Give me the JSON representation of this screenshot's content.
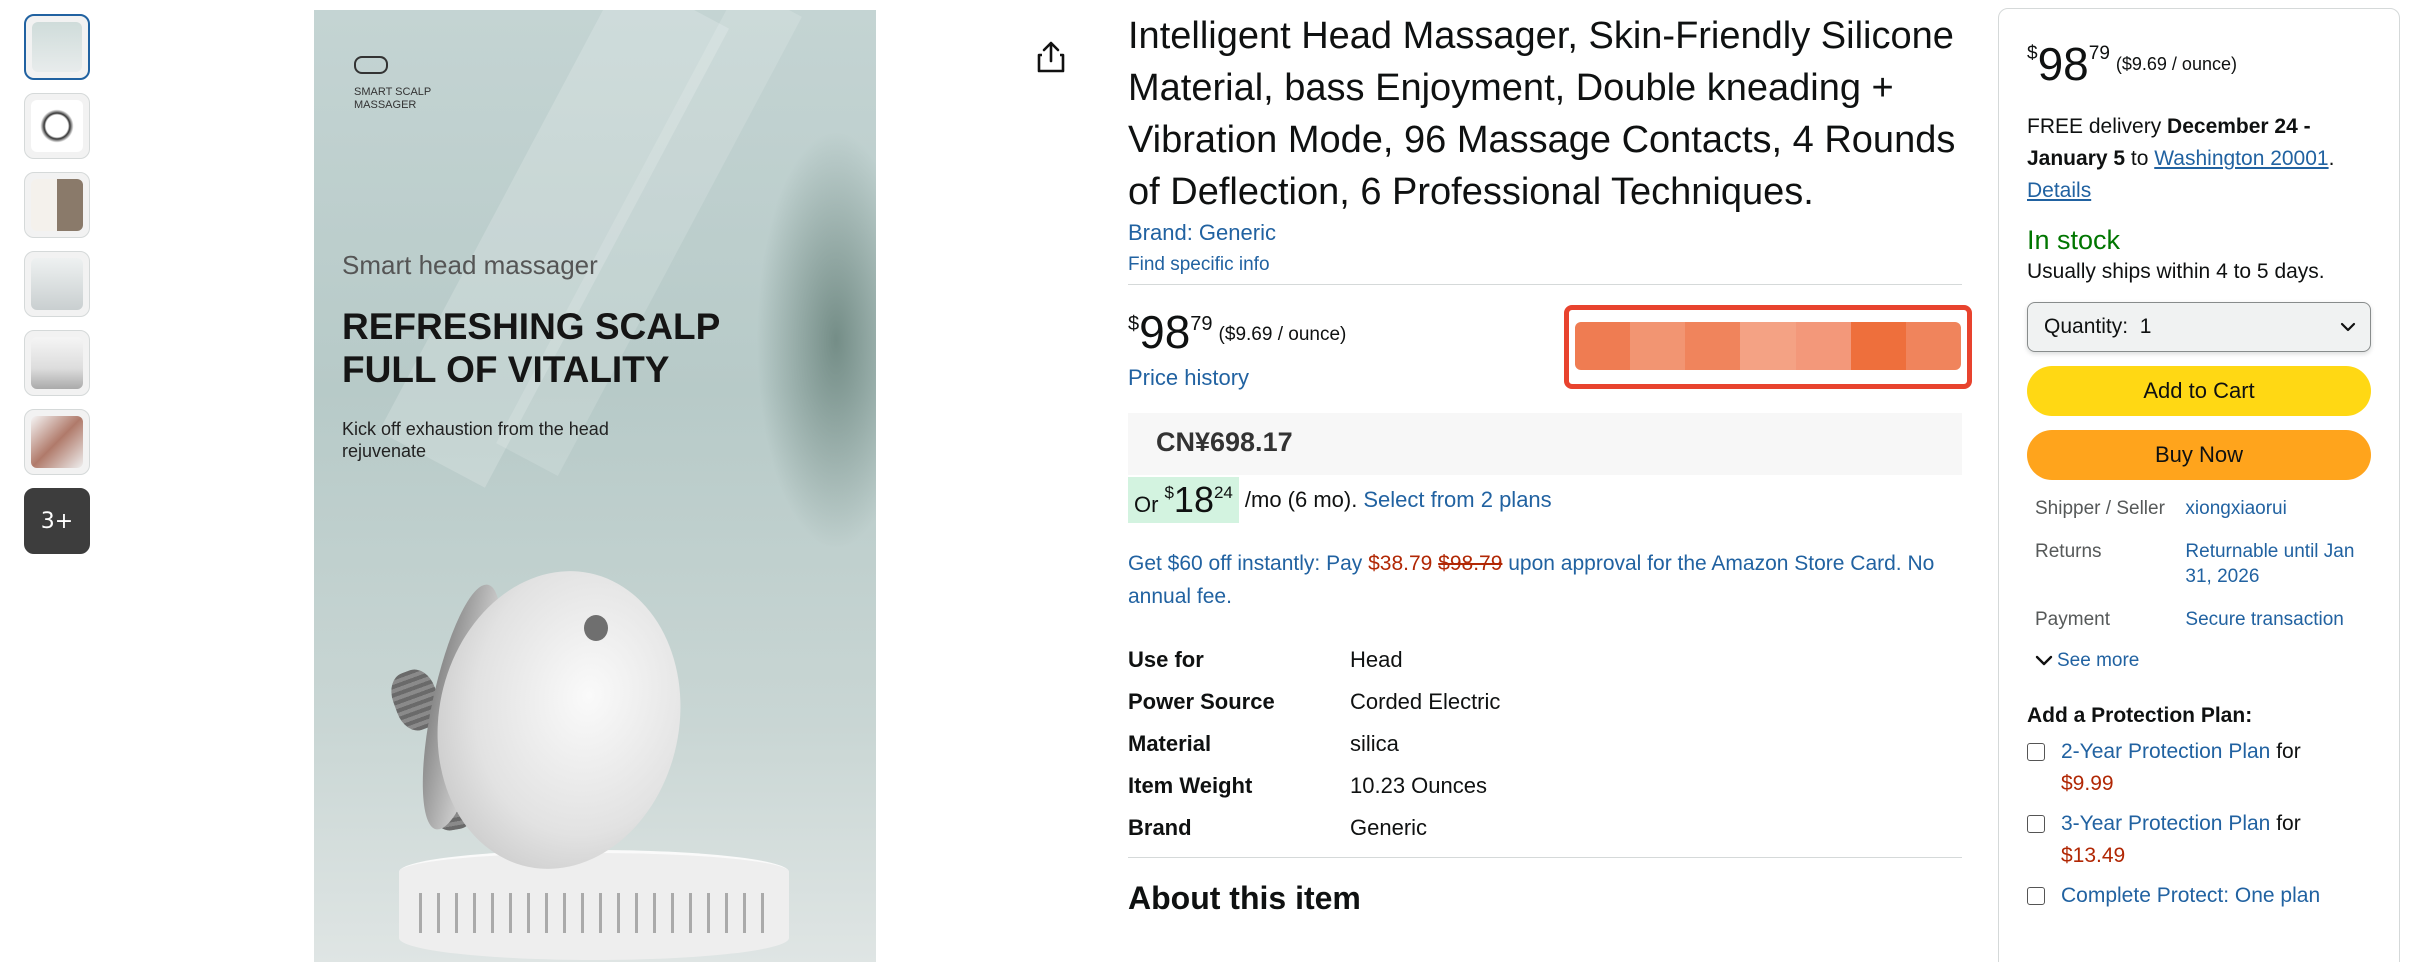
{
  "gallery": {
    "thumbnail_count": 7,
    "more_label": "3+"
  },
  "main_image": {
    "brand": "SMART SCALP MASSAGER",
    "kicker": "Smart head massager",
    "headline": "REFRESHING SCALP FULL OF VITALITY",
    "subtext": "Kick off exhaustion from the head rejuvenate"
  },
  "product": {
    "title": "Intelligent Head Massager, Skin-Friendly Silicone Material, bass Enjoyment, Double kneading + Vibration Mode, 96 Massage Contacts, 4 Rounds of Deflection, 6 Professional Techniques.",
    "brand_link": "Brand: Generic",
    "find_info": "Find specific info",
    "price": {
      "symbol": "$",
      "whole": "98",
      "fraction": "79",
      "unit_price": "($9.69 / ounce)"
    },
    "price_history": "Price history",
    "converted_price": "CN¥698.17",
    "monthly": {
      "or": "Or",
      "symbol": "$",
      "whole": "18",
      "fraction": "24",
      "term": "/mo (6 mo).",
      "plans_link": "Select from 2 plans"
    },
    "offer": {
      "prefix": "Get $60 off instantly: Pay ",
      "new_price": "$38.79",
      "old_price": "$98.79",
      "suffix": " upon approval for the Amazon Store Card. No annual fee."
    },
    "specs": [
      {
        "label": "Use for",
        "value": "Head"
      },
      {
        "label": "Power Source",
        "value": "Corded Electric"
      },
      {
        "label": "Material",
        "value": "silica"
      },
      {
        "label": "Item Weight",
        "value": "10.23 Ounces"
      },
      {
        "label": "Brand",
        "value": "Generic"
      }
    ],
    "about_title": "About this item"
  },
  "buybox": {
    "price": {
      "symbol": "$",
      "whole": "98",
      "fraction": "79",
      "unit_price": "($9.69 / ounce)"
    },
    "delivery": {
      "prefix": "FREE delivery ",
      "dates": "December 24 - January 5",
      "to": " to ",
      "location": "Washington 20001",
      "details": "Details"
    },
    "stock": "In stock",
    "ships": "Usually ships within 4 to 5 days.",
    "quantity_label": "Quantity:",
    "quantity_value": "1",
    "add_to_cart": "Add to Cart",
    "buy_now": "Buy Now",
    "info": [
      {
        "label": "Shipper / Seller",
        "value": "xiongxiaorui"
      },
      {
        "label": "Returns",
        "value": "Returnable until Jan 31, 2026"
      },
      {
        "label": "Payment",
        "value": "Secure transaction"
      }
    ],
    "see_more": "See more",
    "protection_title": "Add a Protection Plan:",
    "plans": [
      {
        "name": "2-Year Protection Plan",
        "for": " for ",
        "price": "$9.99"
      },
      {
        "name": "3-Year Protection Plan",
        "for": " for ",
        "price": "$13.49"
      },
      {
        "name": "Complete Protect: One plan",
        "for": "",
        "price": ""
      }
    ]
  },
  "colors": {
    "link": "#2162a1",
    "price_red": "#b12704",
    "stock_green": "#007600",
    "cart_yellow": "#ffd814",
    "buy_orange": "#ffa41c",
    "redaction_border": "#e8432e"
  }
}
